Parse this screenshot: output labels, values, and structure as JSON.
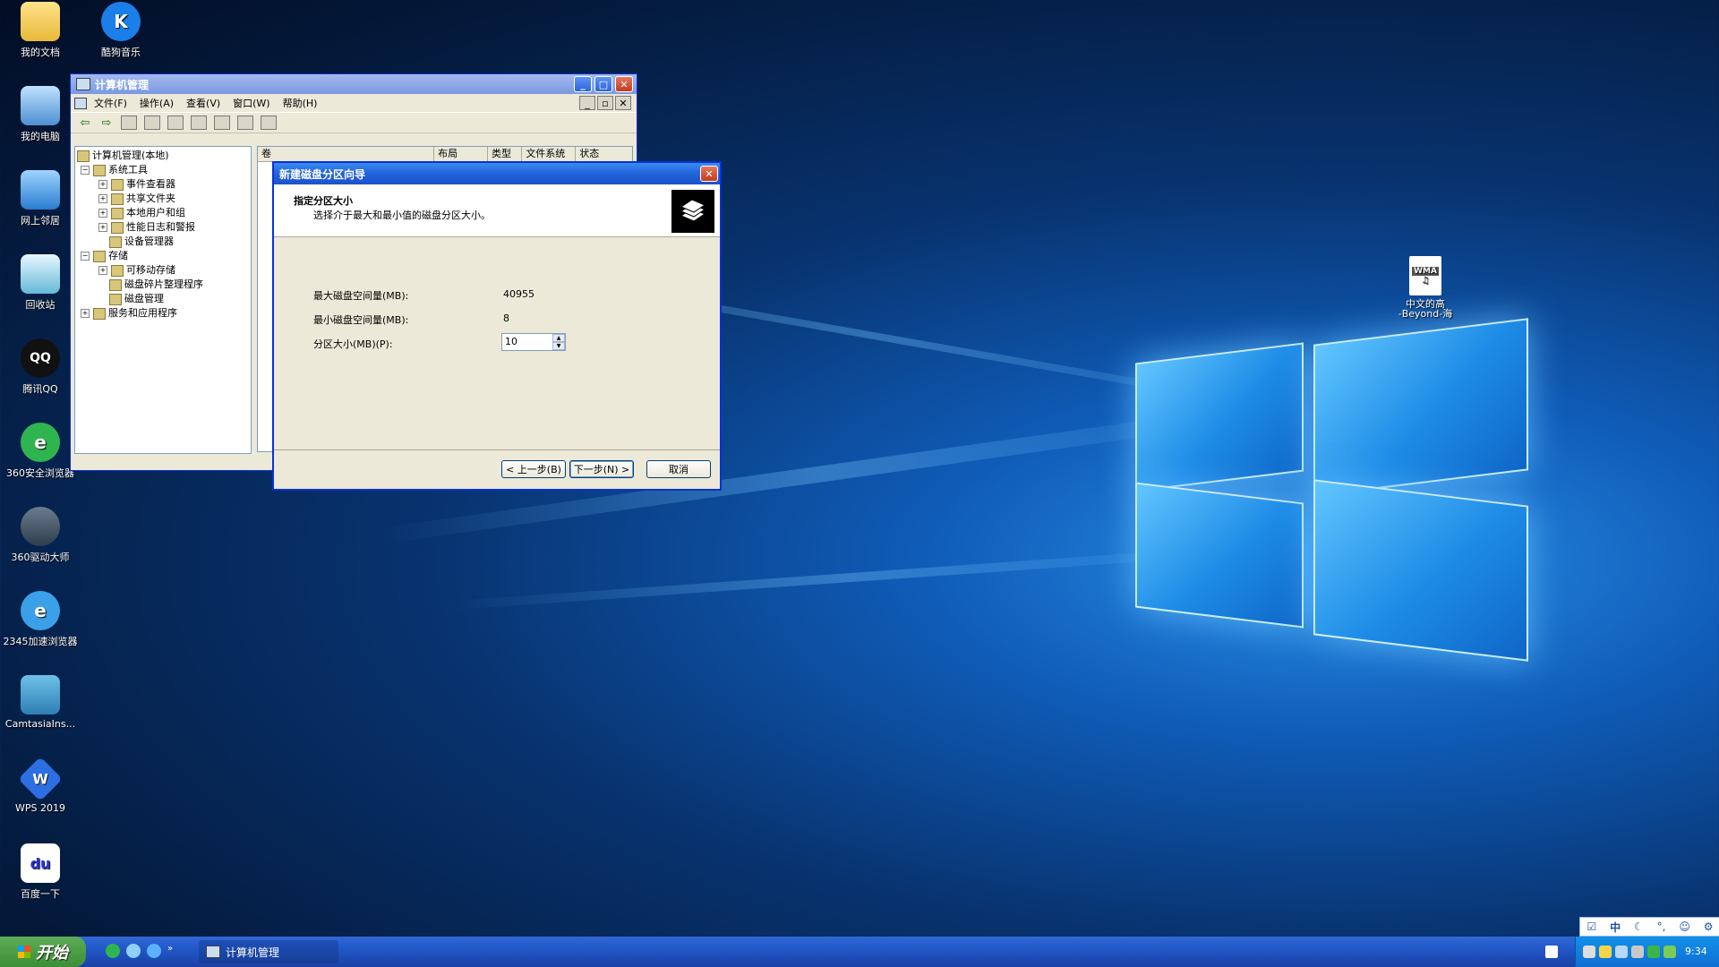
{
  "desktop": {
    "icons": [
      {
        "label": "我的文档"
      },
      {
        "label": "酷狗音乐"
      },
      {
        "label": "我的电脑"
      },
      {
        "label": "网上邻居"
      },
      {
        "label": "回收站"
      },
      {
        "label": "腾讯QQ"
      },
      {
        "label": "360安全浏览器"
      },
      {
        "label": "360驱动大师"
      },
      {
        "label": "2345加速浏览器"
      },
      {
        "label": "CamtasiaIns..."
      },
      {
        "label": "WPS 2019"
      },
      {
        "label": "百度一下"
      },
      {
        "label": "中文的高\n-Beyond-海",
        "badge": "WMA"
      }
    ]
  },
  "mmc": {
    "title": "计算机管理",
    "menu": [
      "文件(F)",
      "操作(A)",
      "查看(V)",
      "窗口(W)",
      "帮助(H)"
    ],
    "tree": [
      {
        "label": "计算机管理(本地)",
        "level": 0
      },
      {
        "label": "系统工具",
        "level": 1
      },
      {
        "label": "事件查看器",
        "level": 2
      },
      {
        "label": "共享文件夹",
        "level": 2
      },
      {
        "label": "本地用户和组",
        "level": 2
      },
      {
        "label": "性能日志和警报",
        "level": 2
      },
      {
        "label": "设备管理器",
        "level": 2
      },
      {
        "label": "存储",
        "level": 1
      },
      {
        "label": "可移动存储",
        "level": 2
      },
      {
        "label": "磁盘碎片整理程序",
        "level": 2
      },
      {
        "label": "磁盘管理",
        "level": 2
      },
      {
        "label": "服务和应用程序",
        "level": 1
      }
    ],
    "columns": [
      "卷",
      "布局",
      "类型",
      "文件系统",
      "状态"
    ]
  },
  "wizard": {
    "title": "新建磁盘分区向导",
    "heading": "指定分区大小",
    "subheading": "选择介于最大和最小值的磁盘分区大小。",
    "max_label": "最大磁盘空间量(MB):",
    "max_value": "40955",
    "min_label": "最小磁盘空间量(MB):",
    "min_value": "8",
    "size_label": "分区大小(MB)(P):",
    "size_value": "10",
    "back": "< 上一步(B)",
    "next": "下一步(N) >",
    "cancel": "取消"
  },
  "taskbar": {
    "start": "开始",
    "task_label": "计算机管理",
    "clock": "9:34",
    "ime": "中"
  },
  "colors": {
    "xp_blue": "#0831d9",
    "xp_face": "#ece9d8",
    "start_green": "#3c8f37"
  }
}
